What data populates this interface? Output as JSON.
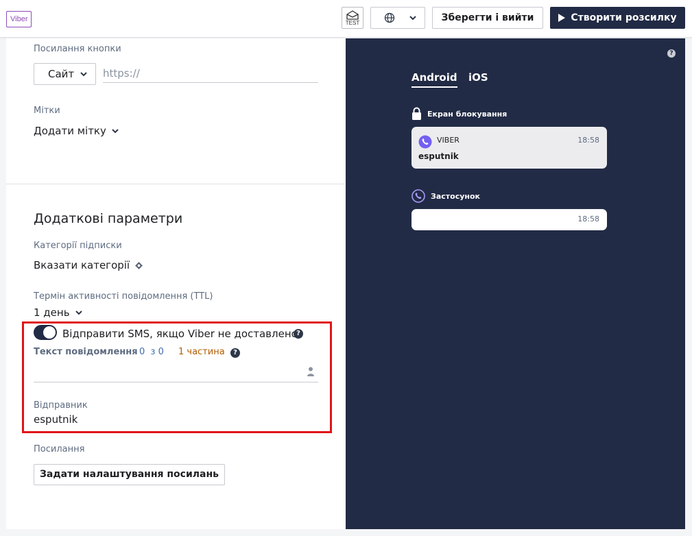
{
  "header": {
    "badge": "Viber",
    "test_label": "TEST",
    "save_label": "Зберегти і вийти",
    "create_label": "Створити розсилку"
  },
  "form": {
    "button_link_label": "Посилання кнопки",
    "link_type": "Сайт",
    "url_placeholder": "https://",
    "tags_label": "Мітки",
    "tags_add": "Додати мітку",
    "extra_title": "Додаткові параметри",
    "categories_label": "Категорії підписки",
    "categories_value": "Вказати категорії",
    "ttl_label": "Термін активності повідомлення (TTL)",
    "ttl_value": "1 день",
    "sms_toggle_label": "Відправити SMS, якщо Viber не доставлено",
    "sms_text_label": "Текст повідомлення",
    "char_count": "0",
    "char_of": "з",
    "char_max": "0",
    "parts": "1 частина",
    "sender_label": "Відправник",
    "sender_value": "esputnik",
    "links_label": "Посилання",
    "links_button": "Задати налаштування посилань"
  },
  "preview": {
    "tabs": [
      "Android",
      "iOS"
    ],
    "lock_screen_label": "Екран блокування",
    "lock_card": {
      "app": "VIBER",
      "time": "18:58",
      "sender": "esputnik"
    },
    "app_label": "Застосунок",
    "app_card": {
      "time": "18:58"
    }
  },
  "colors": {
    "accent_dark": "#222b45",
    "viber_purple": "#7360f2",
    "parts_orange": "#b35c00",
    "count_blue": "#3d6bb3",
    "highlight_red": "#e01418"
  }
}
